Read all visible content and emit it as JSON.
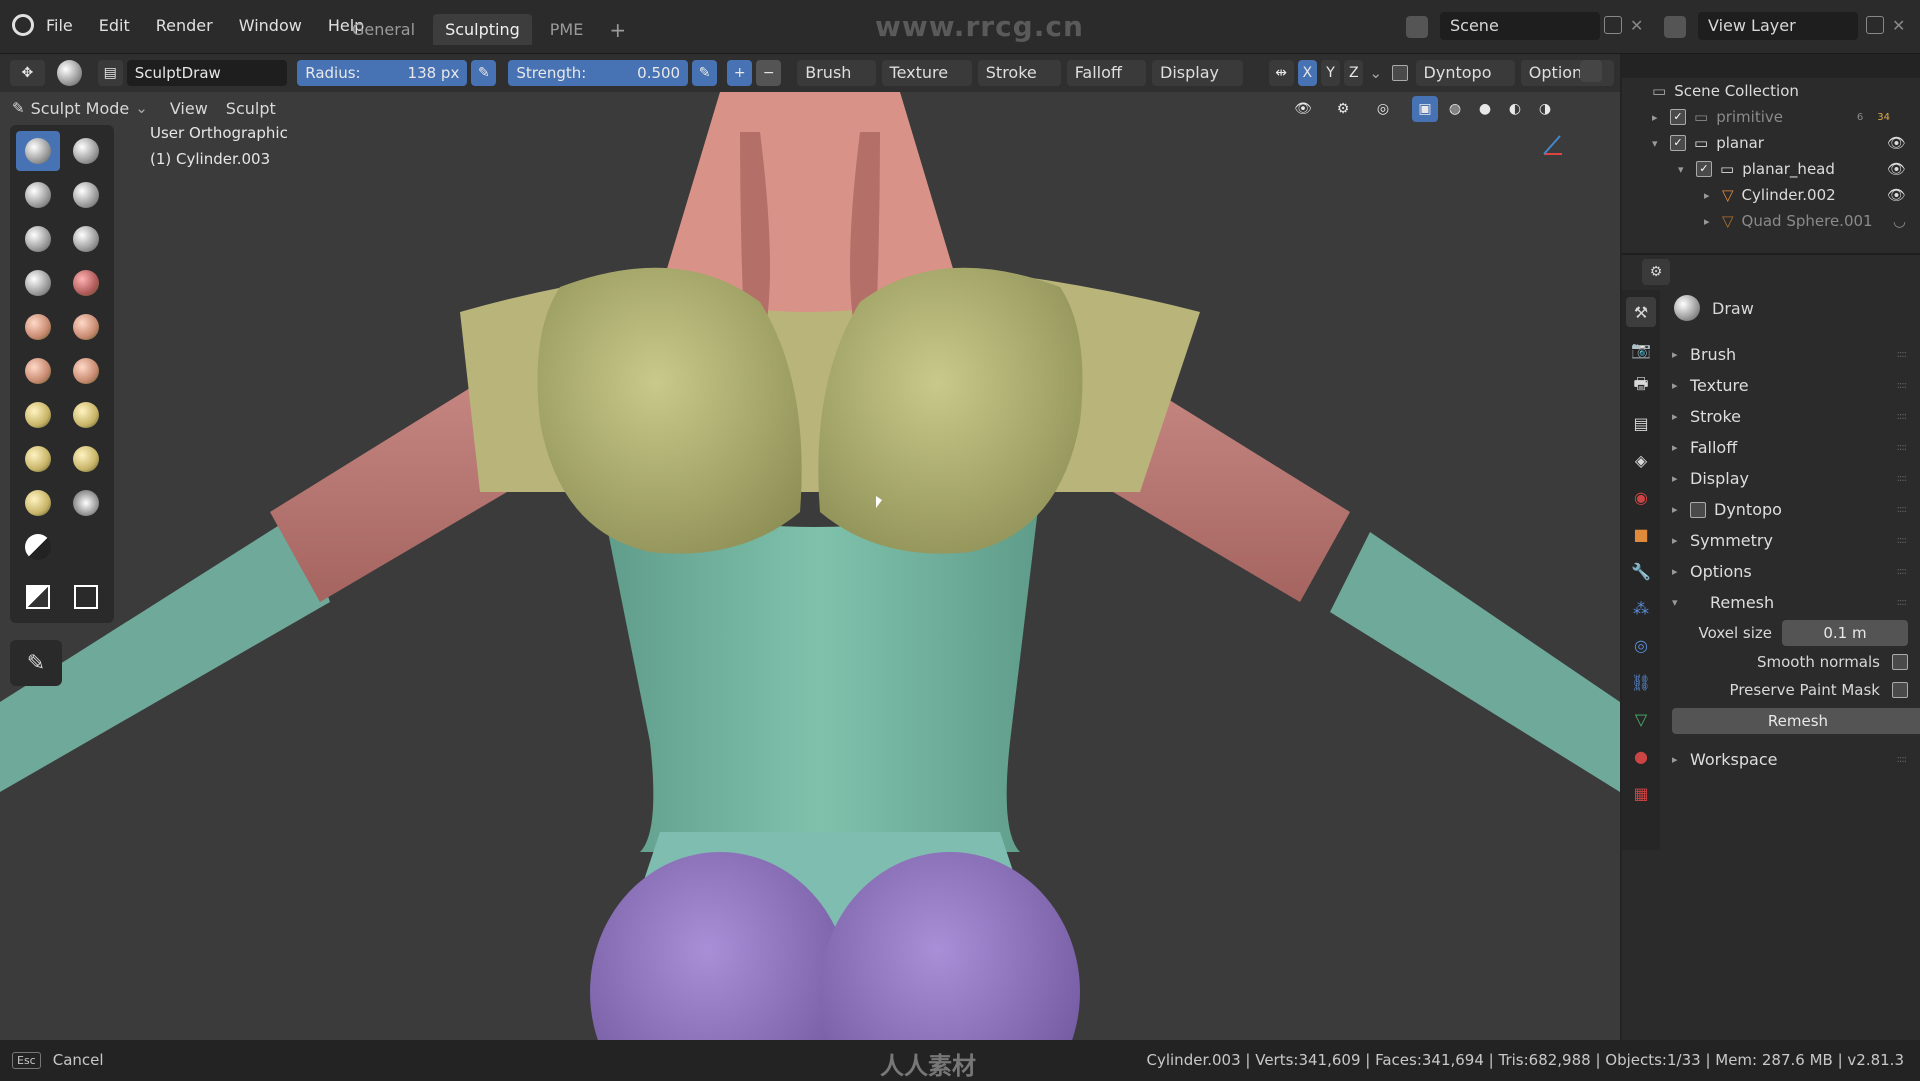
{
  "topbar": {
    "menus": [
      "File",
      "Edit",
      "Render",
      "Window",
      "Help"
    ],
    "workspace_tabs": [
      "General",
      "Sculpting",
      "PME"
    ],
    "active_tab": "Sculpting",
    "add_tab": "+",
    "watermark": "www.rrcg.cn",
    "scene_label": "Scene",
    "view_layer_label": "View Layer"
  },
  "toolheader": {
    "brush_name": "SculptDraw",
    "radius_label": "Radius:",
    "radius_value": "138 px",
    "strength_label": "Strength:",
    "strength_value": "0.500",
    "plus": "+",
    "minus": "−",
    "dropdowns": [
      "Brush",
      "Texture",
      "Stroke",
      "Falloff",
      "Display"
    ],
    "axes": [
      "X",
      "Y",
      "Z"
    ],
    "dyntopo": "Dyntopo",
    "options": "Options"
  },
  "modebar": {
    "mode": "Sculpt Mode",
    "view": "View",
    "sculpt": "Sculpt"
  },
  "viewport": {
    "view_name": "User Orthographic",
    "object_name": "(1) Cylinder.003"
  },
  "outliner": {
    "title": "Scene Collection",
    "rows": [
      {
        "label": "primitive",
        "badge1": "6",
        "badge2": "34"
      },
      {
        "label": "planar"
      },
      {
        "label": "planar_head"
      },
      {
        "label": "Cylinder.002"
      },
      {
        "label": "Quad Sphere.001"
      }
    ]
  },
  "properties": {
    "brush_title": "Draw",
    "panels": [
      "Brush",
      "Texture",
      "Stroke",
      "Falloff",
      "Display",
      "Dyntopo",
      "Symmetry",
      "Options"
    ],
    "remesh": {
      "title": "Remesh",
      "voxel_label": "Voxel size",
      "voxel_value": "0.1 m",
      "smooth_normals": "Smooth normals",
      "preserve_mask": "Preserve Paint Mask",
      "button": "Remesh"
    },
    "workspace": "Workspace"
  },
  "statusbar": {
    "esc_key": "Esc",
    "cancel": "Cancel",
    "watermark": "人人素材",
    "stats": "Cylinder.003 | Verts:341,609 | Faces:341,694 | Tris:682,988 | Objects:1/33 | Mem: 287.6 MB | v2.81.3"
  }
}
